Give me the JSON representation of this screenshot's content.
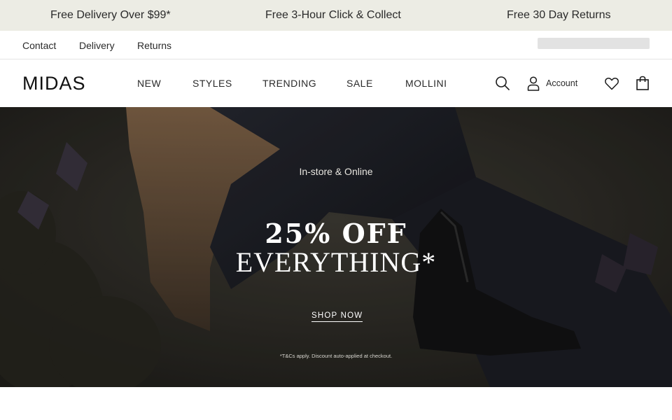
{
  "promo_bar": {
    "items": [
      "Free Delivery Over $99*",
      "Free 3-Hour Click & Collect",
      "Free 30 Day Returns"
    ]
  },
  "utility_nav": {
    "links": [
      "Contact",
      "Delivery",
      "Returns"
    ]
  },
  "header": {
    "logo": "MIDAS",
    "nav": [
      "NEW",
      "STYLES",
      "TRENDING",
      "SALE",
      "MOLLINI"
    ],
    "icons": {
      "search": "search-icon",
      "account": "user-icon",
      "wishlist": "heart-icon",
      "bag": "shopping-bag-icon"
    },
    "account_label": "Account"
  },
  "hero": {
    "subtitle": "In-store & Online",
    "title_line_1": "25% OFF",
    "title_line_2": "EVERYTHING*",
    "cta": "SHOP NOW",
    "disclaimer": "*T&Cs apply. Discount auto-applied at checkout."
  },
  "colors": {
    "promo_bg": "#ecece4",
    "text": "#2a2a2a",
    "hero_bg": "#2b2a26"
  }
}
